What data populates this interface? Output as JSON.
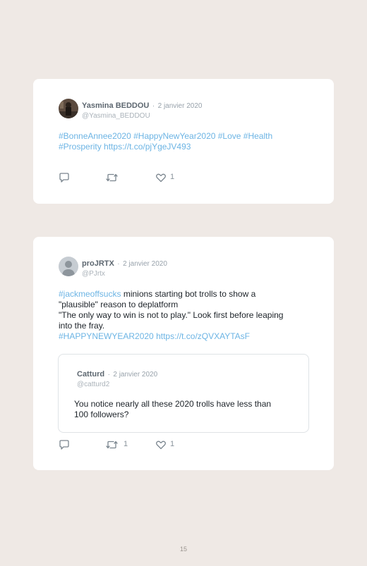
{
  "tweets": [
    {
      "name": "Yasmina BEDDOU",
      "separator": "·",
      "date": "2 janvier 2020",
      "handle": "@Yasmina_BEDDOU",
      "text_parts": {
        "hashtags_line1": "#BonneAnnee2020 #HappyNewYear2020 #Love #Health",
        "hashtags_line2": "#Prosperity",
        "url": "https://t.co/pjYgeJV493"
      },
      "retweets": "",
      "likes": "1"
    },
    {
      "name": "proJRTX",
      "separator": "·",
      "date": "2 janvier 2020",
      "handle": "@PJrtx",
      "text_parts": {
        "hashtag": "#jackmeoffsucks",
        "line1_rest": " minions starting bot trolls to show a",
        "line2": "\"plausible\" reason to deplatform",
        "line3": "\"The only way to win is not to play.\" Look first before leaping",
        "line4": "into the fray.",
        "hashtag2": "#HAPPYNEWYEAR2020",
        "url": "https://t.co/zQVXAYTAsF"
      },
      "retweets": "1",
      "likes": "1",
      "quoted": {
        "name": "Catturd",
        "separator": "·",
        "date": "2 janvier 2020",
        "handle": "@catturd2",
        "line1": "You notice nearly all these 2020 trolls have less than",
        "line2": "100 followers?"
      }
    }
  ],
  "footer": {
    "page_number": "15"
  },
  "icons": {
    "reply": "reply-icon",
    "retweet": "retweet-icon",
    "like": "heart-icon"
  },
  "colors": {
    "background": "#efe9e5",
    "card": "#ffffff",
    "link": "#6cb4e4",
    "icon": "#7a858e"
  }
}
